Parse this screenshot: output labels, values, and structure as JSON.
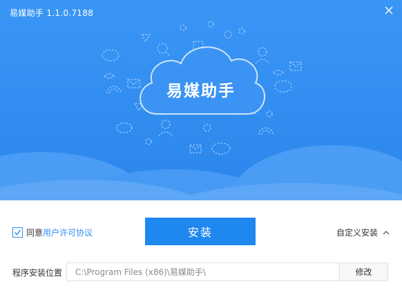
{
  "window": {
    "title": "易媒助手 1.1.0.7188",
    "close_icon": "close-icon"
  },
  "hero": {
    "logo_text": "易媒助手"
  },
  "agreement": {
    "checked": true,
    "prefix": "同意",
    "link": "用户许可协议"
  },
  "install": {
    "label": "安装"
  },
  "custom_install": {
    "label": "自定义安装",
    "icon": "chevron-up-icon"
  },
  "path": {
    "label": "程序安装位置",
    "value": "C:\\Program Files (x86)\\易媒助手\\",
    "modify_label": "修改"
  },
  "colors": {
    "brand_blue": "#2f8ef3",
    "button_blue": "#1e87f0"
  }
}
